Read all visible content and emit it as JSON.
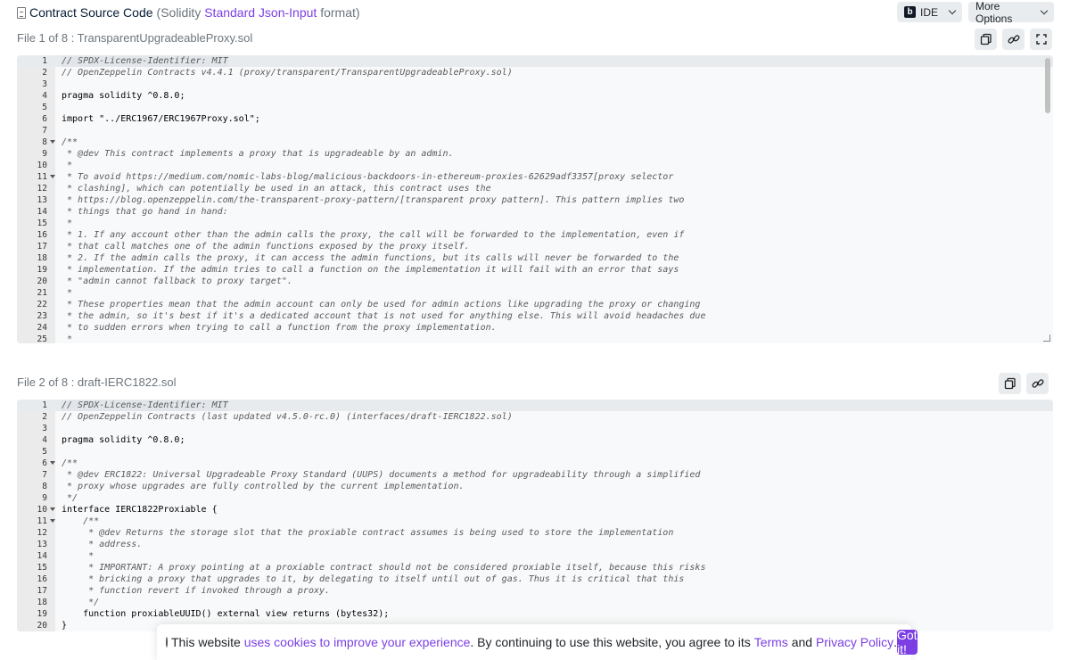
{
  "header": {
    "title": "Contract Source Code",
    "paren_open": "(Solidity ",
    "format_link": "Standard Json-Input",
    "paren_close": " format)",
    "ide_logo": "b",
    "ide_label": "IDE",
    "more_options_label": "More Options"
  },
  "files": [
    {
      "title": "File 1 of 8 : TransparentUpgradeableProxy.sol",
      "lines": [
        {
          "n": "1",
          "fold": false,
          "text": "// SPDX-License-Identifier: MIT",
          "kind": "comment"
        },
        {
          "n": "2",
          "fold": false,
          "text": "// OpenZeppelin Contracts v4.4.1 (proxy/transparent/TransparentUpgradeableProxy.sol)",
          "kind": "comment"
        },
        {
          "n": "3",
          "fold": false,
          "text": "",
          "kind": "code"
        },
        {
          "n": "4",
          "fold": false,
          "text": "pragma solidity ^0.8.0;",
          "kind": "code"
        },
        {
          "n": "5",
          "fold": false,
          "text": "",
          "kind": "code"
        },
        {
          "n": "6",
          "fold": false,
          "text": "import \"../ERC1967/ERC1967Proxy.sol\";",
          "kind": "code"
        },
        {
          "n": "7",
          "fold": false,
          "text": "",
          "kind": "code"
        },
        {
          "n": "8",
          "fold": true,
          "text": "/**",
          "kind": "comment"
        },
        {
          "n": "9",
          "fold": false,
          "text": " * @dev This contract implements a proxy that is upgradeable by an admin.",
          "kind": "comment"
        },
        {
          "n": "10",
          "fold": false,
          "text": " *",
          "kind": "comment"
        },
        {
          "n": "11",
          "fold": true,
          "text": " * To avoid https://medium.com/nomic-labs-blog/malicious-backdoors-in-ethereum-proxies-62629adf3357[proxy selector",
          "kind": "comment"
        },
        {
          "n": "12",
          "fold": false,
          "text": " * clashing], which can potentially be used in an attack, this contract uses the",
          "kind": "comment"
        },
        {
          "n": "13",
          "fold": false,
          "text": " * https://blog.openzeppelin.com/the-transparent-proxy-pattern/[transparent proxy pattern]. This pattern implies two",
          "kind": "comment"
        },
        {
          "n": "14",
          "fold": false,
          "text": " * things that go hand in hand:",
          "kind": "comment"
        },
        {
          "n": "15",
          "fold": false,
          "text": " *",
          "kind": "comment"
        },
        {
          "n": "16",
          "fold": false,
          "text": " * 1. If any account other than the admin calls the proxy, the call will be forwarded to the implementation, even if",
          "kind": "comment"
        },
        {
          "n": "17",
          "fold": false,
          "text": " * that call matches one of the admin functions exposed by the proxy itself.",
          "kind": "comment"
        },
        {
          "n": "18",
          "fold": false,
          "text": " * 2. If the admin calls the proxy, it can access the admin functions, but its calls will never be forwarded to the",
          "kind": "comment"
        },
        {
          "n": "19",
          "fold": false,
          "text": " * implementation. If the admin tries to call a function on the implementation it will fail with an error that says",
          "kind": "comment"
        },
        {
          "n": "20",
          "fold": false,
          "text": " * \"admin cannot fallback to proxy target\".",
          "kind": "comment"
        },
        {
          "n": "21",
          "fold": false,
          "text": " *",
          "kind": "comment"
        },
        {
          "n": "22",
          "fold": false,
          "text": " * These properties mean that the admin account can only be used for admin actions like upgrading the proxy or changing",
          "kind": "comment"
        },
        {
          "n": "23",
          "fold": false,
          "text": " * the admin, so it's best if it's a dedicated account that is not used for anything else. This will avoid headaches due",
          "kind": "comment"
        },
        {
          "n": "24",
          "fold": false,
          "text": " * to sudden errors when trying to call a function from the proxy implementation.",
          "kind": "comment"
        },
        {
          "n": "25",
          "fold": false,
          "text": " *",
          "kind": "comment"
        }
      ]
    },
    {
      "title": "File 2 of 8 : draft-IERC1822.sol",
      "lines": [
        {
          "n": "1",
          "fold": false,
          "text": "// SPDX-License-Identifier: MIT",
          "kind": "comment"
        },
        {
          "n": "2",
          "fold": false,
          "text": "// OpenZeppelin Contracts (last updated v4.5.0-rc.0) (interfaces/draft-IERC1822.sol)",
          "kind": "comment"
        },
        {
          "n": "3",
          "fold": false,
          "text": "",
          "kind": "code"
        },
        {
          "n": "4",
          "fold": false,
          "text": "pragma solidity ^0.8.0;",
          "kind": "code"
        },
        {
          "n": "5",
          "fold": false,
          "text": "",
          "kind": "code"
        },
        {
          "n": "6",
          "fold": true,
          "text": "/**",
          "kind": "comment"
        },
        {
          "n": "7",
          "fold": false,
          "text": " * @dev ERC1822: Universal Upgradeable Proxy Standard (UUPS) documents a method for upgradeability through a simplified",
          "kind": "comment"
        },
        {
          "n": "8",
          "fold": false,
          "text": " * proxy whose upgrades are fully controlled by the current implementation.",
          "kind": "comment"
        },
        {
          "n": "9",
          "fold": false,
          "text": " */",
          "kind": "comment"
        },
        {
          "n": "10",
          "fold": true,
          "text": "interface IERC1822Proxiable {",
          "kind": "code"
        },
        {
          "n": "11",
          "fold": true,
          "text": "    /**",
          "kind": "comment"
        },
        {
          "n": "12",
          "fold": false,
          "text": "     * @dev Returns the storage slot that the proxiable contract assumes is being used to store the implementation",
          "kind": "comment"
        },
        {
          "n": "13",
          "fold": false,
          "text": "     * address.",
          "kind": "comment"
        },
        {
          "n": "14",
          "fold": false,
          "text": "     *",
          "kind": "comment"
        },
        {
          "n": "15",
          "fold": false,
          "text": "     * IMPORTANT: A proxy pointing at a proxiable contract should not be considered proxiable itself, because this risks",
          "kind": "comment"
        },
        {
          "n": "16",
          "fold": false,
          "text": "     * bricking a proxy that upgrades to it, by delegating to itself until out of gas. Thus it is critical that this",
          "kind": "comment"
        },
        {
          "n": "17",
          "fold": false,
          "text": "     * function revert if invoked through a proxy.",
          "kind": "comment"
        },
        {
          "n": "18",
          "fold": false,
          "text": "     */",
          "kind": "comment"
        },
        {
          "n": "19",
          "fold": false,
          "text": "    function proxiableUUID() external view returns (bytes32);",
          "kind": "code"
        },
        {
          "n": "20",
          "fold": false,
          "text": "}",
          "kind": "code"
        }
      ]
    }
  ],
  "cookie": {
    "text1": "This website ",
    "link1": "uses cookies to improve your experience",
    "text2": ". By continuing to use this website, you agree to its ",
    "link2": "Terms",
    "text3": " and ",
    "link3": "Privacy Policy",
    "text4": ".",
    "button": "Got it!"
  },
  "colors": {
    "accent": "#7b3fe4",
    "gutter": "#ebebeb",
    "editor_bg": "#f8f9fa",
    "button_bg": "#e9ecef"
  }
}
